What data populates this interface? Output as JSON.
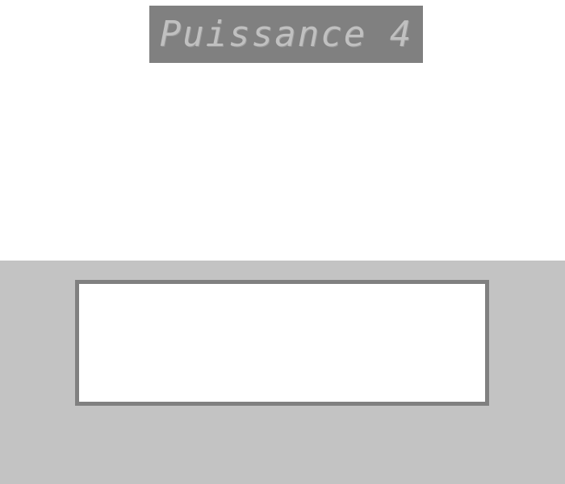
{
  "header": {
    "title": "Puissance 4"
  },
  "colors": {
    "title_banner": "#808080",
    "title_text": "#c0c0c0",
    "bottom_panel": "#c3c3c3",
    "box_border": "#808080",
    "box_fill": "#ffffff"
  }
}
